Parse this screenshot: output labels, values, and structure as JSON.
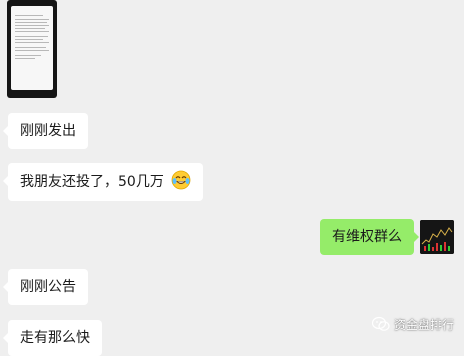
{
  "chat": {
    "messages": [
      {
        "side": "left",
        "type": "image"
      },
      {
        "side": "left",
        "text": "刚刚发出"
      },
      {
        "side": "left",
        "text": "我朋友还投了，50几万",
        "emoji": "tears-of-joy-emoji"
      },
      {
        "side": "right",
        "text": "有维权群么"
      },
      {
        "side": "left",
        "text": "刚刚公告"
      },
      {
        "side": "left",
        "text": "走有那么快"
      }
    ],
    "bubble_colors": {
      "incoming": "#ffffff",
      "outgoing": "#95ec69"
    },
    "background": "#efefef"
  },
  "watermark": {
    "text": "资金盘排行"
  }
}
